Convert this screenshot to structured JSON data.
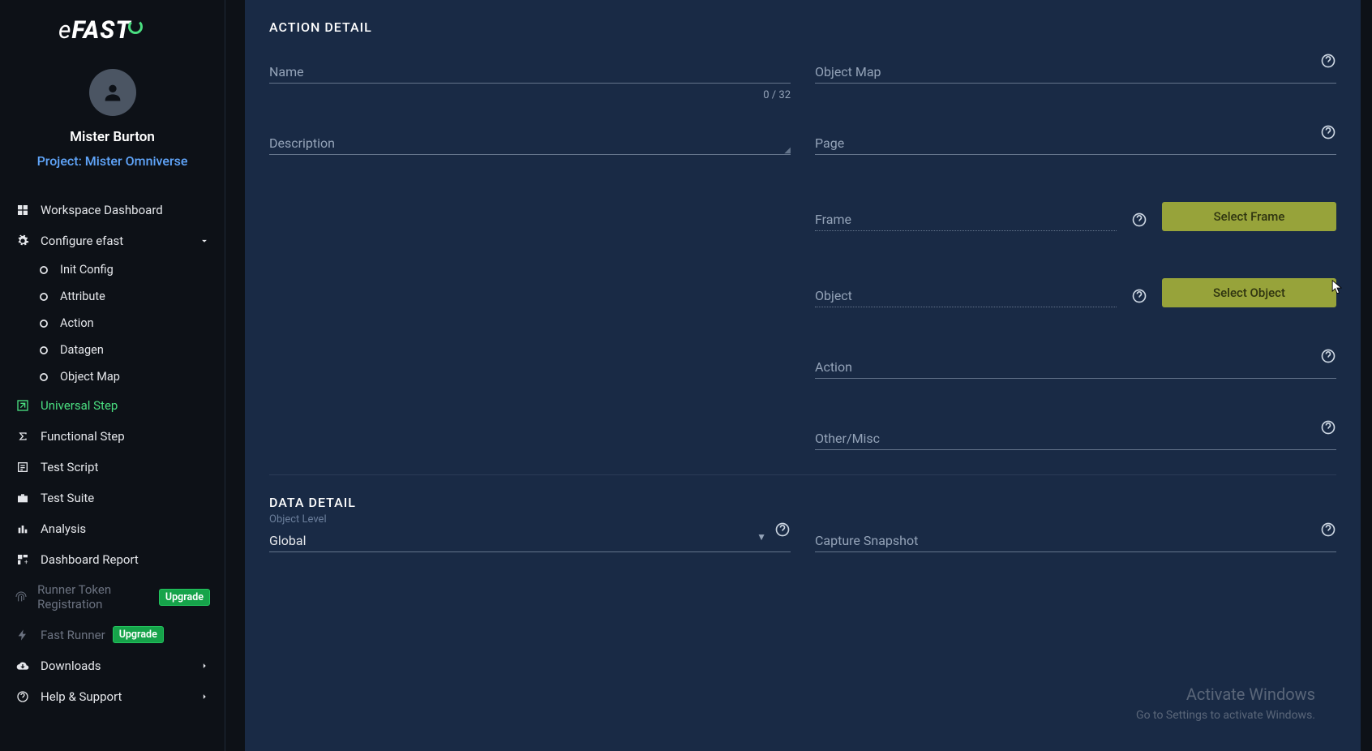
{
  "app": {
    "logo_e": "e",
    "logo_fast": "FAST"
  },
  "profile": {
    "username": "Mister Burton",
    "project": "Project: Mister Omniverse"
  },
  "sidebar": {
    "workspace_dashboard": "Workspace Dashboard",
    "configure": "Configure efast",
    "configure_sub": {
      "init_config": "Init Config",
      "attribute": "Attribute",
      "action": "Action",
      "datagen": "Datagen",
      "object_map": "Object Map"
    },
    "universal_step": "Universal Step",
    "functional_step": "Functional Step",
    "test_script": "Test Script",
    "test_suite": "Test Suite",
    "analysis": "Analysis",
    "dashboard_report": "Dashboard Report",
    "runner_token": "Runner Token Registration",
    "fast_runner": "Fast Runner",
    "downloads": "Downloads",
    "help": "Help & Support",
    "upgrade": "Upgrade"
  },
  "action_detail": {
    "section": "ACTION DETAIL",
    "name_label": "Name",
    "name_counter": "0 / 32",
    "description_label": "Description",
    "object_map_label": "Object Map",
    "page_label": "Page",
    "frame_label": "Frame",
    "select_frame_btn": "Select Frame",
    "object_label": "Object",
    "select_object_btn": "Select Object",
    "action_label": "Action",
    "other_label": "Other/Misc"
  },
  "data_detail": {
    "section": "DATA DETAIL",
    "object_level_label": "Object Level",
    "object_level_value": "Global",
    "capture_snapshot_label": "Capture Snapshot"
  },
  "watermark": {
    "title": "Activate Windows",
    "sub": "Go to Settings to activate Windows."
  }
}
